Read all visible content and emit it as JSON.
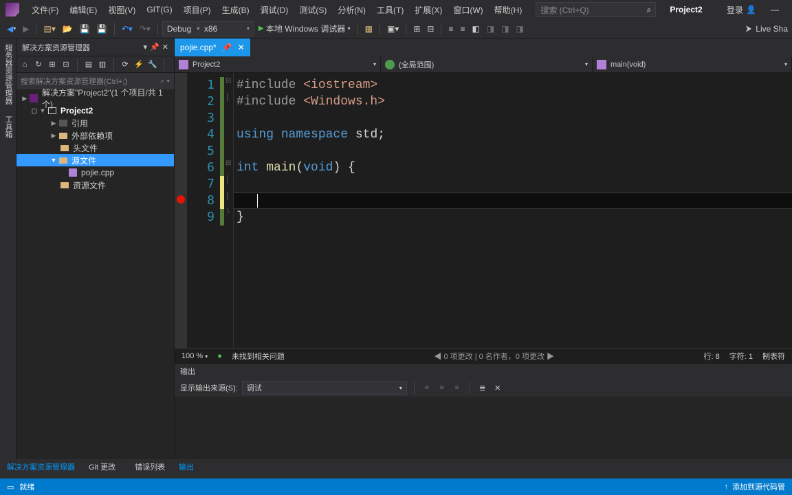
{
  "menu": [
    "文件(F)",
    "编辑(E)",
    "视图(V)",
    "GIT(G)",
    "项目(P)",
    "生成(B)",
    "调试(D)",
    "测试(S)",
    "分析(N)",
    "工具(T)",
    "扩展(X)",
    "窗口(W)",
    "帮助(H)"
  ],
  "search_placeholder": "搜索 (Ctrl+Q)",
  "project_name": "Project2",
  "login": "登录",
  "live_share": "Live Sha",
  "toolbar": {
    "config": "Debug",
    "platform": "x86",
    "debugger": "本地 Windows 调试器"
  },
  "left_tabs": [
    "服务器资源管理器",
    "工具箱"
  ],
  "solution": {
    "title": "解决方案资源管理器",
    "search": "搜索解决方案资源管理器(Ctrl+;)",
    "root": "解决方案\"Project2\"(1 个项目/共 1 个)",
    "project": "Project2",
    "nodes": [
      "引用",
      "外部依赖项",
      "头文件",
      "源文件",
      "资源文件"
    ],
    "srcfile": "pojie.cpp"
  },
  "editor": {
    "tab": "pojie.cpp*",
    "nav_project": "Project2",
    "nav_scope": "(全局范围)",
    "nav_func": "main(void)",
    "lines": [
      "1",
      "2",
      "3",
      "4",
      "5",
      "6",
      "7",
      "8",
      "9"
    ],
    "zoom": "100 %",
    "issues": "未找到相关问题",
    "changes": "0 项更改 | 0 名作者，0 项更改",
    "pos_line": "行: 8",
    "pos_char": "字符: 1",
    "pos_tab": "制表符"
  },
  "code": {
    "l1_pre": "#include ",
    "l1_inc": "<iostream>",
    "l2_pre": "#include ",
    "l2_inc": "<Windows.h>",
    "l4_a": "using ",
    "l4_b": "namespace ",
    "l4_c": "std",
    "l4_d": ";",
    "l6_a": "int ",
    "l6_b": "main",
    "l6_c": "(",
    "l6_d": "void",
    "l6_e": ") {",
    "l9": "}"
  },
  "output": {
    "title": "输出",
    "from_label": "显示输出来源(S):",
    "from_value": "调试"
  },
  "bottom_tabs_left": [
    "解决方案资源管理器",
    "Git 更改"
  ],
  "bottom_tabs_right": [
    "错误列表",
    "输出"
  ],
  "status": {
    "ready": "就绪",
    "addsrc": "添加到源代码管"
  }
}
